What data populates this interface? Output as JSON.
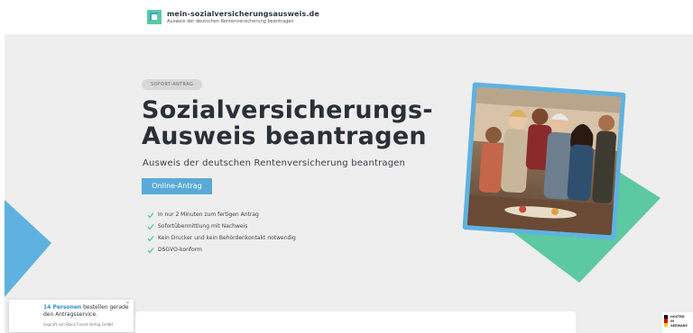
{
  "header": {
    "brand_title": "mein-sozialversicherungsausweis.de",
    "brand_subtitle": "Ausweis der deutschen Rentenversicherung beantragen"
  },
  "hero": {
    "badge": "SOFORT-ANTRAG",
    "headline_line1": "Sozialversicherungs-",
    "headline_line2": "Ausweis beantragen",
    "subline": "Ausweis der deutschen Rentenversicherung beantragen",
    "cta_label": "Online-Antrag",
    "features": [
      "In nur 2 Minuten zum fertigen Antrag",
      "Sofortübermittlung mit Nachweis",
      "Kein Drucker und kein Behördenkontakt notwendig",
      "DSGVO-konform"
    ]
  },
  "toast": {
    "count": "14 Personen",
    "message": " bestellen gerade den Antragsservice.",
    "footer": "Geprüft von Black Forest Verlag GmbH",
    "close": "×"
  },
  "hosted_badge": {
    "line1": "HOSTED",
    "line2": "IN",
    "line3": "GERMANY"
  },
  "icons": {
    "logo": "logo-mark-icon",
    "check": "check-icon",
    "close": "close-icon",
    "flag": "german-flag-icon"
  },
  "colors": {
    "accent_blue": "#5aaad8",
    "accent_green": "#5cc9a0",
    "hero_bg": "#eeeeee",
    "headline": "#2a2f38"
  }
}
